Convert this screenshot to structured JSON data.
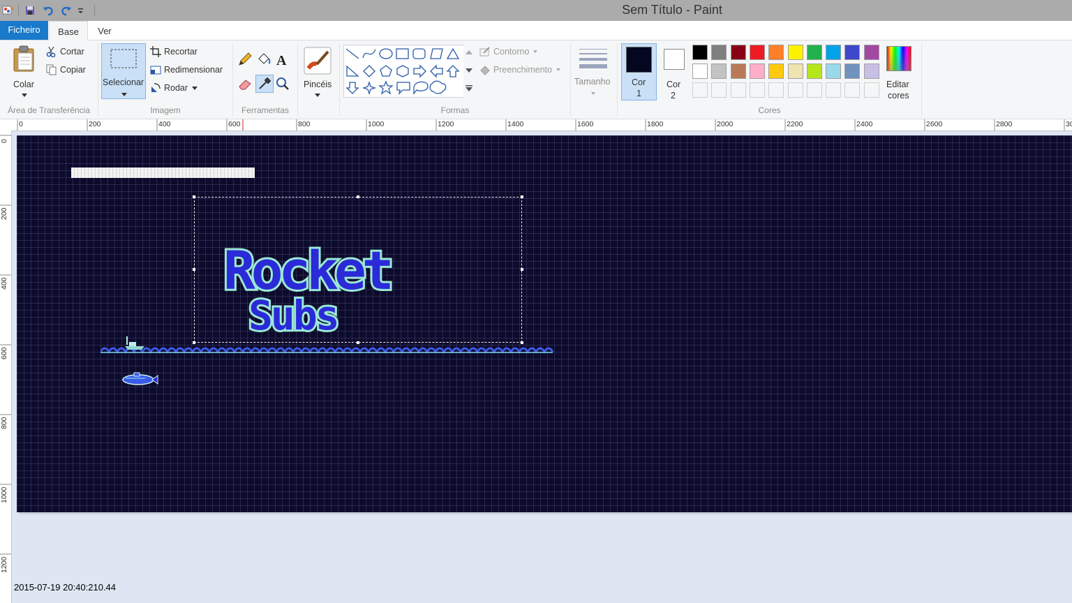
{
  "window": {
    "title": "Sem Título - Paint"
  },
  "tabs": {
    "file": "Ficheiro",
    "home": "Base",
    "view": "Ver"
  },
  "clipboard": {
    "paste": "Colar",
    "cut": "Cortar",
    "copy": "Copiar",
    "label": "Área de Transferência"
  },
  "image": {
    "select": "Selecionar",
    "crop": "Recortar",
    "resize": "Redimensionar",
    "rotate": "Rodar",
    "label": "Imagem"
  },
  "tools": {
    "label": "Ferramentas"
  },
  "brushes": {
    "label": "Pincéis"
  },
  "shapes": {
    "outline": "Contorno",
    "fill": "Preenchimento",
    "label": "Formas"
  },
  "size": {
    "label": "Tamanho"
  },
  "colors": {
    "color1_line1": "Cor",
    "color1_line2": "1",
    "color2_line1": "Cor",
    "color2_line2": "2",
    "edit_line1": "Editar",
    "edit_line2": "cores",
    "label": "Cores",
    "color1_value": "#050620",
    "color2_value": "#ffffff",
    "palette_row1": [
      "#000000",
      "#7f7f7f",
      "#880015",
      "#ed1c24",
      "#ff7f27",
      "#fff200",
      "#22b14c",
      "#00a2e8",
      "#3f48cc",
      "#a349a4"
    ],
    "palette_row2": [
      "#ffffff",
      "#c3c3c3",
      "#b97a57",
      "#ffaec9",
      "#ffc90e",
      "#efe4b0",
      "#b5e61d",
      "#99d9ea",
      "#7092be",
      "#c8bfe7"
    ]
  },
  "ruler": {
    "top": [
      "0",
      "200",
      "400",
      "600",
      "800",
      "1000",
      "1200",
      "1400",
      "1600",
      "1800",
      "2000",
      "2200",
      "2400",
      "2600",
      "2800",
      "30"
    ],
    "left": [
      "0",
      "200",
      "400",
      "600",
      "800",
      "1000",
      "1200"
    ]
  },
  "artwork": {
    "logo_line1": "Rocket",
    "logo_line2": "Subs"
  },
  "status": {
    "timestamp": "2015-07-19 20:40:210.44"
  }
}
